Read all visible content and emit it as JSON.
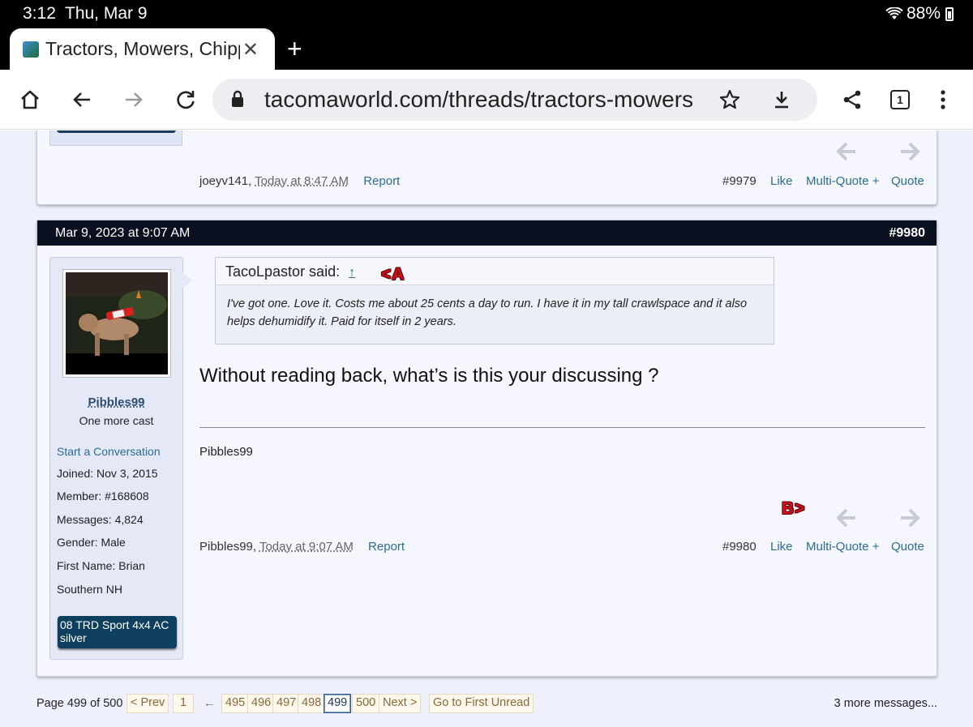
{
  "status": {
    "time": "3:12",
    "date": "Thu, Mar 9",
    "battery": "88%"
  },
  "tab": {
    "title": "Tractors, Mowers, Chippers",
    "favicon": "tacomaworld-favicon"
  },
  "toolbar": {
    "url": "tacomaworld.com/threads/tractors-mowers",
    "tab_count": "1"
  },
  "prev_post": {
    "author": "joeyv141",
    "timestamp": "Today at 8:47 AM",
    "report": "Report",
    "number": "#9979",
    "like": "Like",
    "multiquote": "Multi-Quote +",
    "quote": "Quote"
  },
  "post": {
    "date": "Mar 9, 2023 at 9:07 AM",
    "number": "#9980",
    "user": {
      "name": "Pibbles99",
      "title": "One more cast",
      "start_conversation": "Start a Conversation",
      "joined": "Joined:  Nov 3, 2015",
      "member": "Member:  #168608",
      "messages": "Messages:  4,824",
      "gender": "Gender:  Male",
      "first_name": "First Name:  Brian",
      "location": "Southern NH",
      "vehicle_line1": "08 TRD Sport 4x4 AC",
      "vehicle_line2": "silver"
    },
    "quote": {
      "author": "TacoLpastor said:",
      "jump": "↑",
      "text": "I've got one. Love it. Costs me about 25 cents a day to run. I have it in my tall crawlspace and it also helps dehumidify it. Paid for itself in 2 years."
    },
    "marker_a": "<A",
    "marker_b": "B>",
    "message": "Without reading back, what’s is this your discussing ?",
    "signature": "Pibbles99",
    "footer": {
      "author": "Pibbles99",
      "timestamp": "Today at 9:07 AM",
      "report": "Report",
      "number": "#9980",
      "like": "Like",
      "multiquote": "Multi-Quote +",
      "quote": "Quote"
    }
  },
  "pager": {
    "label": "Page 499 of 500",
    "prev": "< Prev",
    "first": "1",
    "ellipsis": "←",
    "pages": [
      "495",
      "496",
      "497",
      "498",
      "499",
      "500"
    ],
    "current": "499",
    "next": "Next >",
    "first_unread": "Go to First Unread",
    "more": "3 more messages..."
  }
}
